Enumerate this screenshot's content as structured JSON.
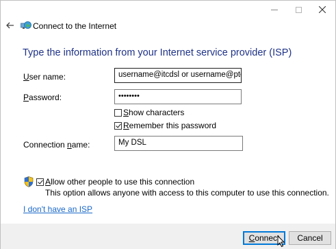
{
  "window": {
    "title": "Connect to the Internet",
    "controls": {
      "minimize": "minimize-icon",
      "maximize": "maximize-icon",
      "close": "close-icon"
    }
  },
  "header": {
    "back_icon": "back-arrow-icon",
    "network_icon": "network-globe-icon",
    "title": "Connect to the Internet"
  },
  "main": {
    "heading": "Type the information from your Internet service provider (ISP)",
    "username": {
      "label_access": "U",
      "label_rest": "ser name:",
      "value": "username@itcdsl or username@ptelco-dsl"
    },
    "password": {
      "label_access": "P",
      "label_rest": "assword:",
      "value": "••••••••"
    },
    "show_characters": {
      "access": "S",
      "rest": "how characters",
      "checked": false
    },
    "remember_password": {
      "access": "R",
      "rest": "emember this password",
      "checked": true
    },
    "connection_name": {
      "label_before": "Connection ",
      "label_access": "n",
      "label_after": "ame:",
      "value": "My DSL"
    },
    "allow_others": {
      "access": "A",
      "rest": "llow other people to use this connection",
      "checked": true,
      "icon": "uac-shield-icon",
      "description": "This option allows anyone with access to this computer to use this connection."
    },
    "no_isp_link": {
      "before": "I ",
      "access": "d",
      "after": "on't have an ISP"
    }
  },
  "footer": {
    "connect_access": "C",
    "connect_rest": "onnect",
    "cancel_label": "Cancel"
  },
  "colors": {
    "heading": "#1e3287",
    "link": "#1a68c9",
    "default_button_border": "#0078d7",
    "footer_bg": "#f0f0f0"
  }
}
